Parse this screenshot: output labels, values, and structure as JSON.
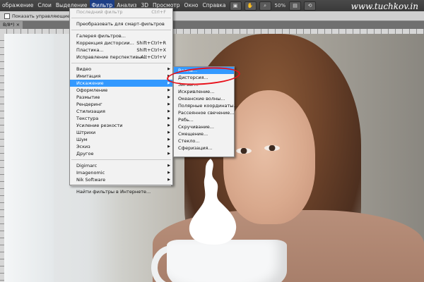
{
  "menubar": {
    "items": [
      "ображение",
      "Слои",
      "Выделение",
      "Фильтр",
      "Анализ",
      "3D",
      "Просмотр",
      "Окно",
      "Справка"
    ],
    "zoom": "50%"
  },
  "watermark": "www.tuchkov.in",
  "options_bar": {
    "checkbox_label": "Показать управляющие элеме"
  },
  "doc_tab": "В/8*) ×",
  "filter_menu": {
    "last_filter": {
      "label": "Последний фильтр",
      "shortcut": "Ctrl+F"
    },
    "smart": "Преобразовать для смарт-фильтров",
    "gallery": "Галерея фильтров...",
    "lens": {
      "label": "Коррекция дисторсии...",
      "shortcut": "Shift+Ctrl+R"
    },
    "liquify": {
      "label": "Пластика...",
      "shortcut": "Shift+Ctrl+X"
    },
    "vanishing": {
      "label": "Исправление перспективы...",
      "shortcut": "Alt+Ctrl+V"
    },
    "groups": [
      "Видео",
      "Имитация",
      "Искажение",
      "Оформление",
      "Размытие",
      "Рендеринг",
      "Стилизация",
      "Текстура",
      "Усиление резкости",
      "Штрихи",
      "Шум",
      "Эскиз",
      "Другое"
    ],
    "highlighted": "Искажение",
    "plugins": [
      "Digimarc",
      "Imagenomic",
      "Nik Software"
    ],
    "online": "Найти фильтры в Интернете..."
  },
  "distort_submenu": {
    "items": [
      "Волна...",
      "Дисторсия...",
      "Зигзаг...",
      "Искривление...",
      "Океанские волны...",
      "Полярные координаты...",
      "Рассеянное свечение...",
      "Рябь...",
      "Скручивание...",
      "Смещение...",
      "Стекло...",
      "Сферизация..."
    ],
    "highlighted": "Волна..."
  },
  "colors": {
    "highlight": "#3399ff",
    "annotation": "#e8101a",
    "active_menu": "#1d3f86"
  }
}
